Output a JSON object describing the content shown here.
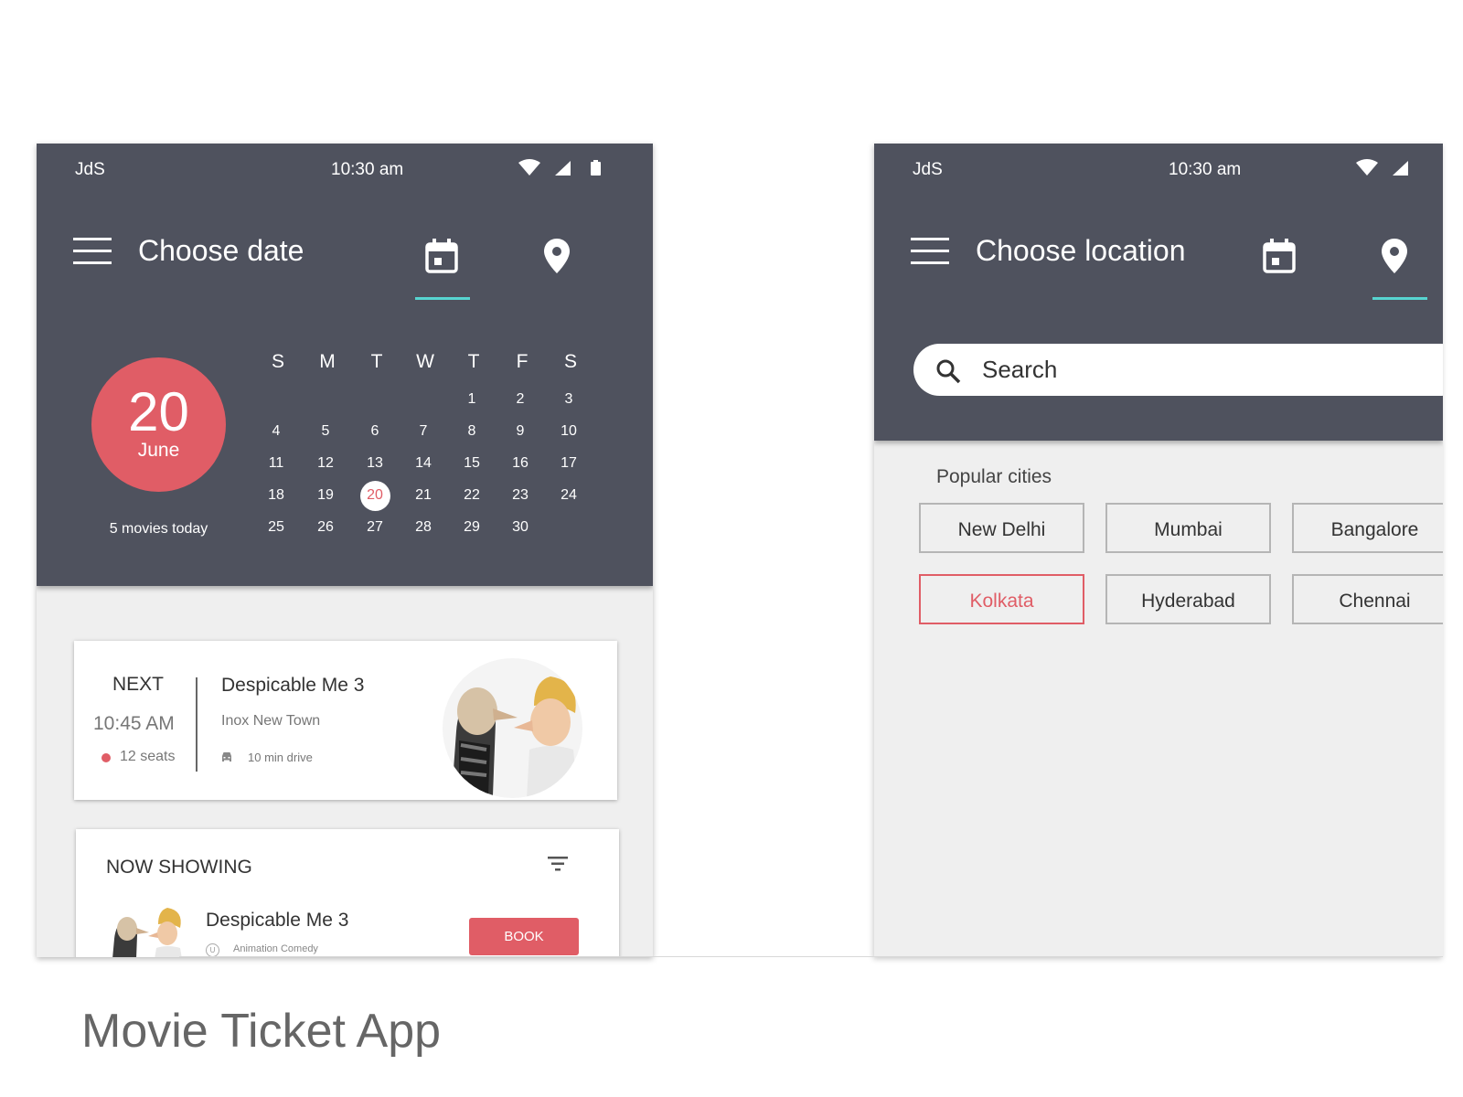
{
  "status_bar": {
    "carrier": "JdS",
    "time": "10:30 am"
  },
  "date_screen": {
    "title": "Choose date",
    "selected_day": "20",
    "selected_month": "June",
    "movies_today": "5 movies today",
    "weekdays": [
      "S",
      "M",
      "T",
      "W",
      "T",
      "F",
      "S"
    ],
    "calendar_rows": [
      [
        "",
        "",
        "",
        "",
        "1",
        "2",
        "3"
      ],
      [
        "4",
        "5",
        "6",
        "7",
        "8",
        "9",
        "10"
      ],
      [
        "11",
        "12",
        "13",
        "14",
        "15",
        "16",
        "17"
      ],
      [
        "18",
        "19",
        "20",
        "21",
        "22",
        "23",
        "24"
      ],
      [
        "25",
        "26",
        "27",
        "28",
        "29",
        "30",
        ""
      ]
    ],
    "next_show": {
      "label": "NEXT",
      "time": "10:45 AM",
      "seats": "12 seats",
      "movie": "Despicable Me 3",
      "theatre": "Inox New Town",
      "drive": "10 min drive"
    },
    "now_showing": {
      "heading": "NOW SHOWING",
      "movie": "Despicable Me 3",
      "rating": "U",
      "genre": "Animation Comedy",
      "book_label": "BOOK"
    }
  },
  "location_screen": {
    "title": "Choose location",
    "search_placeholder": "Search",
    "popular_label": "Popular cities",
    "cities": [
      "New Delhi",
      "Mumbai",
      "Bangalore",
      "Kolkata",
      "Hyderabad",
      "Chennai"
    ],
    "selected_city": "Kolkata"
  },
  "caption": "Movie Ticket App",
  "colors": {
    "header": "#4f525e",
    "accent": "#e05d66",
    "tab_indicator": "#57d4d0",
    "background": "#efefef"
  },
  "icons": [
    "menu-icon",
    "calendar-icon",
    "location-pin-icon",
    "wifi-icon",
    "signal-icon",
    "battery-icon",
    "search-icon",
    "filter-icon",
    "car-icon"
  ]
}
